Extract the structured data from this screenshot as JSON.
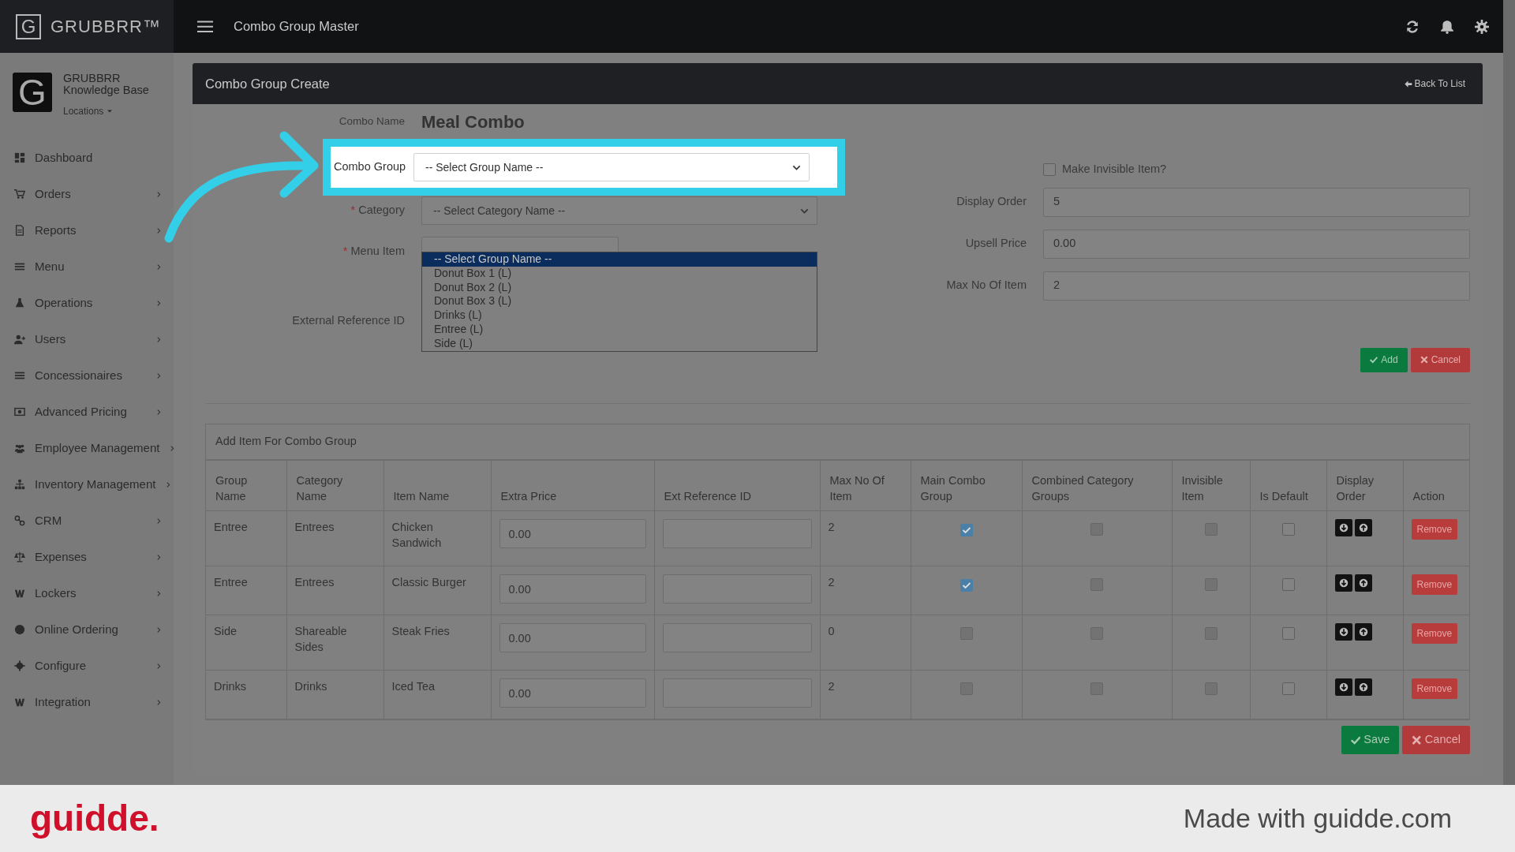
{
  "brand": {
    "logo_letter": "G",
    "name": "GRUBBRR™"
  },
  "topbar": {
    "title": "Combo Group Master"
  },
  "account": {
    "logo_letter": "G",
    "name": "GRUBBRR",
    "subtitle": "Knowledge Base",
    "locations": "Locations"
  },
  "sidebar": {
    "items": [
      {
        "label": "Dashboard",
        "has_submenu": false
      },
      {
        "label": "Orders",
        "has_submenu": true
      },
      {
        "label": "Reports",
        "has_submenu": true
      },
      {
        "label": "Menu",
        "has_submenu": true
      },
      {
        "label": "Operations",
        "has_submenu": true
      },
      {
        "label": "Users",
        "has_submenu": true
      },
      {
        "label": "Concessionaires",
        "has_submenu": true
      },
      {
        "label": "Advanced Pricing",
        "has_submenu": true
      },
      {
        "label": "Employee Management",
        "has_submenu": true
      },
      {
        "label": "Inventory Management",
        "has_submenu": true
      },
      {
        "label": "CRM",
        "has_submenu": true
      },
      {
        "label": "Expenses",
        "has_submenu": true
      },
      {
        "label": "Lockers",
        "has_submenu": true
      },
      {
        "label": "Online Ordering",
        "has_submenu": true
      },
      {
        "label": "Configure",
        "has_submenu": true
      },
      {
        "label": "Integration",
        "has_submenu": true
      }
    ]
  },
  "panel": {
    "title": "Combo Group Create",
    "back_link": "Back To List"
  },
  "form": {
    "combo_name": {
      "label": "Combo Name",
      "value": "Meal Combo"
    },
    "combo_group": {
      "label": "Combo Group",
      "value": "-- Select Group Name --",
      "highlighted": true
    },
    "category": {
      "label": "Category",
      "required_mark": "*",
      "value": "-- Select Category Name --"
    },
    "menu_item": {
      "label": "Menu Item",
      "required_mark": "*"
    },
    "external_reference": {
      "label": "External Reference ID"
    },
    "dropdown": {
      "options": [
        {
          "label": "-- Select Group Name --",
          "selected": true
        },
        {
          "label": "Donut Box 1 (L)",
          "selected": false
        },
        {
          "label": "Donut Box 2 (L)",
          "selected": false
        },
        {
          "label": "Donut Box 3 (L)",
          "selected": false
        },
        {
          "label": "Drinks (L)",
          "selected": false
        },
        {
          "label": "Entree (L)",
          "selected": false
        },
        {
          "label": "Side (L)",
          "selected": false
        }
      ]
    },
    "make_invisible": {
      "label": "Make Invisible Item?",
      "checked": false
    },
    "fields": [
      {
        "label": "Display Order",
        "value": "5"
      },
      {
        "label": "Upsell Price",
        "value": "0.00"
      },
      {
        "label": "Max No Of Item",
        "value": "2"
      }
    ],
    "buttons": [
      {
        "label": "Add",
        "kind": "success"
      },
      {
        "label": "Cancel",
        "kind": "danger"
      }
    ]
  },
  "table": {
    "title": "Add Item For Combo Group",
    "columns": [
      "Group Name",
      "Category Name",
      "Item Name",
      "Extra Price",
      "Ext Reference ID",
      "Max No Of Item",
      "Main Combo Group",
      "Combined Category Groups",
      "Invisible Item",
      "Is Default",
      "Display Order",
      "Action"
    ],
    "rows": [
      {
        "group": "Entree",
        "category": "Entrees",
        "item": "Chicken Sandwich",
        "extra_price": "0.00",
        "max_items": "2",
        "main_combo": {
          "checked": true,
          "disabled": false
        },
        "combined": {
          "checked": false,
          "disabled": true
        },
        "invisible": {
          "checked": false,
          "disabled": true
        },
        "is_default": {
          "checked": false,
          "disabled": false
        },
        "action": "Remove"
      },
      {
        "group": "Entree",
        "category": "Entrees",
        "item": "Classic Burger",
        "extra_price": "0.00",
        "max_items": "2",
        "main_combo": {
          "checked": true,
          "disabled": false
        },
        "combined": {
          "checked": false,
          "disabled": true
        },
        "invisible": {
          "checked": false,
          "disabled": true
        },
        "is_default": {
          "checked": false,
          "disabled": false
        },
        "action": "Remove"
      },
      {
        "group": "Side",
        "category": "Shareable Sides",
        "item": "Steak Fries",
        "extra_price": "0.00",
        "max_items": "0",
        "main_combo": {
          "checked": false,
          "disabled": true
        },
        "combined": {
          "checked": false,
          "disabled": true
        },
        "invisible": {
          "checked": false,
          "disabled": true
        },
        "is_default": {
          "checked": false,
          "disabled": false
        },
        "action": "Remove"
      },
      {
        "group": "Drinks",
        "category": "Drinks",
        "item": "Iced Tea",
        "extra_price": "0.00",
        "max_items": "2",
        "main_combo": {
          "checked": false,
          "disabled": true
        },
        "combined": {
          "checked": false,
          "disabled": true
        },
        "invisible": {
          "checked": false,
          "disabled": true
        },
        "is_default": {
          "checked": false,
          "disabled": false
        },
        "action": "Remove"
      }
    ]
  },
  "footer_buttons": [
    {
      "label": "Save",
      "kind": "success"
    },
    {
      "label": "Cancel",
      "kind": "danger"
    }
  ],
  "guide_footer": {
    "brand": "guidde.",
    "text": "Made with guidde.com"
  }
}
